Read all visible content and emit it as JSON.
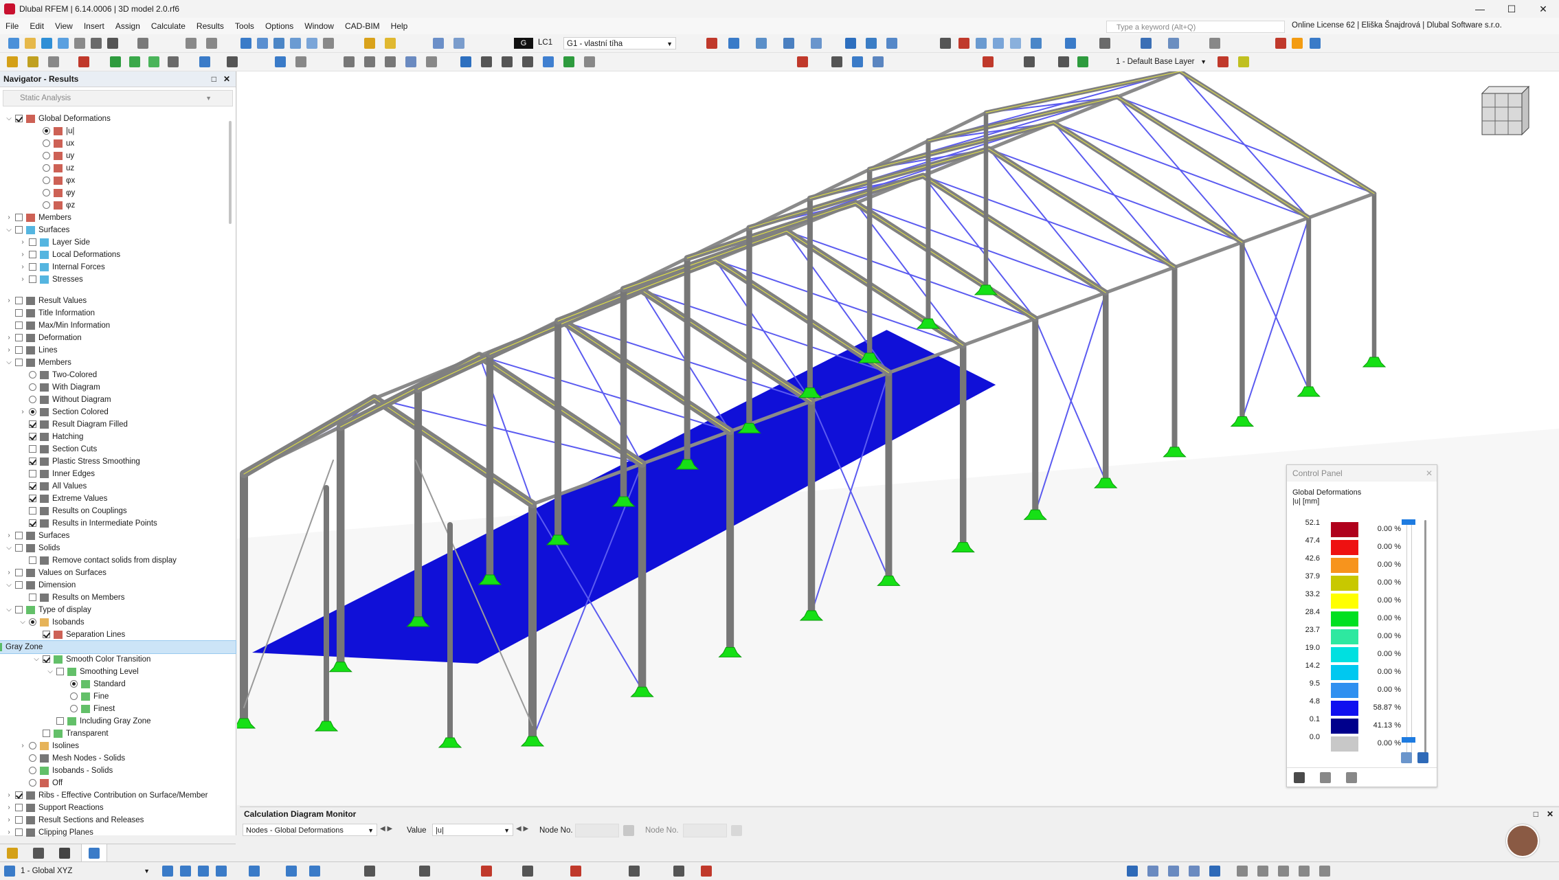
{
  "window": {
    "title": "Dlubal RFEM | 6.14.0006 | 3D model 2.0.rf6"
  },
  "menu": [
    "File",
    "Edit",
    "View",
    "Insert",
    "Assign",
    "Calculate",
    "Results",
    "Tools",
    "Options",
    "Window",
    "CAD-BIM",
    "Help"
  ],
  "search": {
    "placeholder": "Type a keyword (Alt+Q)"
  },
  "license": "Online License 62 | Eliška Šnajdrová | Dlubal Software s.r.o.",
  "toolbar": {
    "loadcase_badge": "G",
    "loadcase_id": "LC1",
    "loadcase_name": "G1 - vlastní tíha",
    "layer": "1 - Default Base Layer"
  },
  "navigator": {
    "title": "Navigator - Results",
    "analysis": "Static Analysis",
    "items": [
      {
        "label": "Global Deformations"
      },
      {
        "label": "|u|"
      },
      {
        "label": "ux"
      },
      {
        "label": "uy"
      },
      {
        "label": "uz"
      },
      {
        "label": "φx"
      },
      {
        "label": "φy"
      },
      {
        "label": "φz"
      },
      {
        "label": "Members"
      },
      {
        "label": "Surfaces"
      },
      {
        "label": "Layer Side"
      },
      {
        "label": "Local Deformations"
      },
      {
        "label": "Internal Forces"
      },
      {
        "label": "Stresses"
      },
      {
        "label": "Result Values"
      },
      {
        "label": "Title Information"
      },
      {
        "label": "Max/Min Information"
      },
      {
        "label": "Deformation"
      },
      {
        "label": "Lines"
      },
      {
        "label": "Members"
      },
      {
        "label": "Two-Colored"
      },
      {
        "label": "With Diagram"
      },
      {
        "label": "Without Diagram"
      },
      {
        "label": "Section Colored"
      },
      {
        "label": "Result Diagram Filled"
      },
      {
        "label": "Hatching"
      },
      {
        "label": "Section Cuts"
      },
      {
        "label": "Plastic Stress Smoothing"
      },
      {
        "label": "Inner Edges"
      },
      {
        "label": "All Values"
      },
      {
        "label": "Extreme Values"
      },
      {
        "label": "Results on Couplings"
      },
      {
        "label": "Results in Intermediate Points"
      },
      {
        "label": "Surfaces"
      },
      {
        "label": "Solids"
      },
      {
        "label": "Remove contact solids from display"
      },
      {
        "label": "Values on Surfaces"
      },
      {
        "label": "Dimension"
      },
      {
        "label": "Results on Members"
      },
      {
        "label": "Type of display"
      },
      {
        "label": "Isobands"
      },
      {
        "label": "Separation Lines"
      },
      {
        "label": "Gray Zone"
      },
      {
        "label": "Smooth Color Transition"
      },
      {
        "label": "Smoothing Level"
      },
      {
        "label": "Standard"
      },
      {
        "label": "Fine"
      },
      {
        "label": "Finest"
      },
      {
        "label": "Including Gray Zone"
      },
      {
        "label": "Transparent"
      },
      {
        "label": "Isolines"
      },
      {
        "label": "Mesh Nodes - Solids"
      },
      {
        "label": "Isobands - Solids"
      },
      {
        "label": "Off"
      },
      {
        "label": "Ribs - Effective Contribution on Surface/Member"
      },
      {
        "label": "Support Reactions"
      },
      {
        "label": "Result Sections and Releases"
      },
      {
        "label": "Clipping Planes"
      }
    ]
  },
  "control_panel": {
    "title": "Control Panel",
    "heading": "Global Deformations",
    "unit": "|u| [mm]",
    "values": [
      "52.1",
      "47.4",
      "42.6",
      "37.9",
      "33.2",
      "28.4",
      "23.7",
      "19.0",
      "14.2",
      "9.5",
      "4.8",
      "0.1",
      "0.0"
    ],
    "bands": [
      {
        "color": "#b0001c",
        "pct": "0.00 %"
      },
      {
        "color": "#ee1111",
        "pct": "0.00 %"
      },
      {
        "color": "#f7941d",
        "pct": "0.00 %"
      },
      {
        "color": "#c8c800",
        "pct": "0.00 %"
      },
      {
        "color": "#ffff00",
        "pct": "0.00 %"
      },
      {
        "color": "#00e020",
        "pct": "0.00 %"
      },
      {
        "color": "#2ee8a0",
        "pct": "0.00 %"
      },
      {
        "color": "#00e0e0",
        "pct": "0.00 %"
      },
      {
        "color": "#00c8f0",
        "pct": "0.00 %"
      },
      {
        "color": "#2f90f0",
        "pct": "0.00 %"
      },
      {
        "color": "#1010f0",
        "pct": "58.87 %"
      },
      {
        "color": "#00008c",
        "pct": "41.13 %"
      },
      {
        "color": "#c8c8c8",
        "pct": "0.00 %"
      }
    ]
  },
  "calc_monitor": {
    "title": "Calculation Diagram Monitor",
    "combo": "Nodes - Global Deformations",
    "value_label": "Value",
    "value": "|u|",
    "node_label": "Node No.",
    "node_label2": "Node No."
  },
  "status": {
    "coord_system": "1 - Global XYZ"
  }
}
